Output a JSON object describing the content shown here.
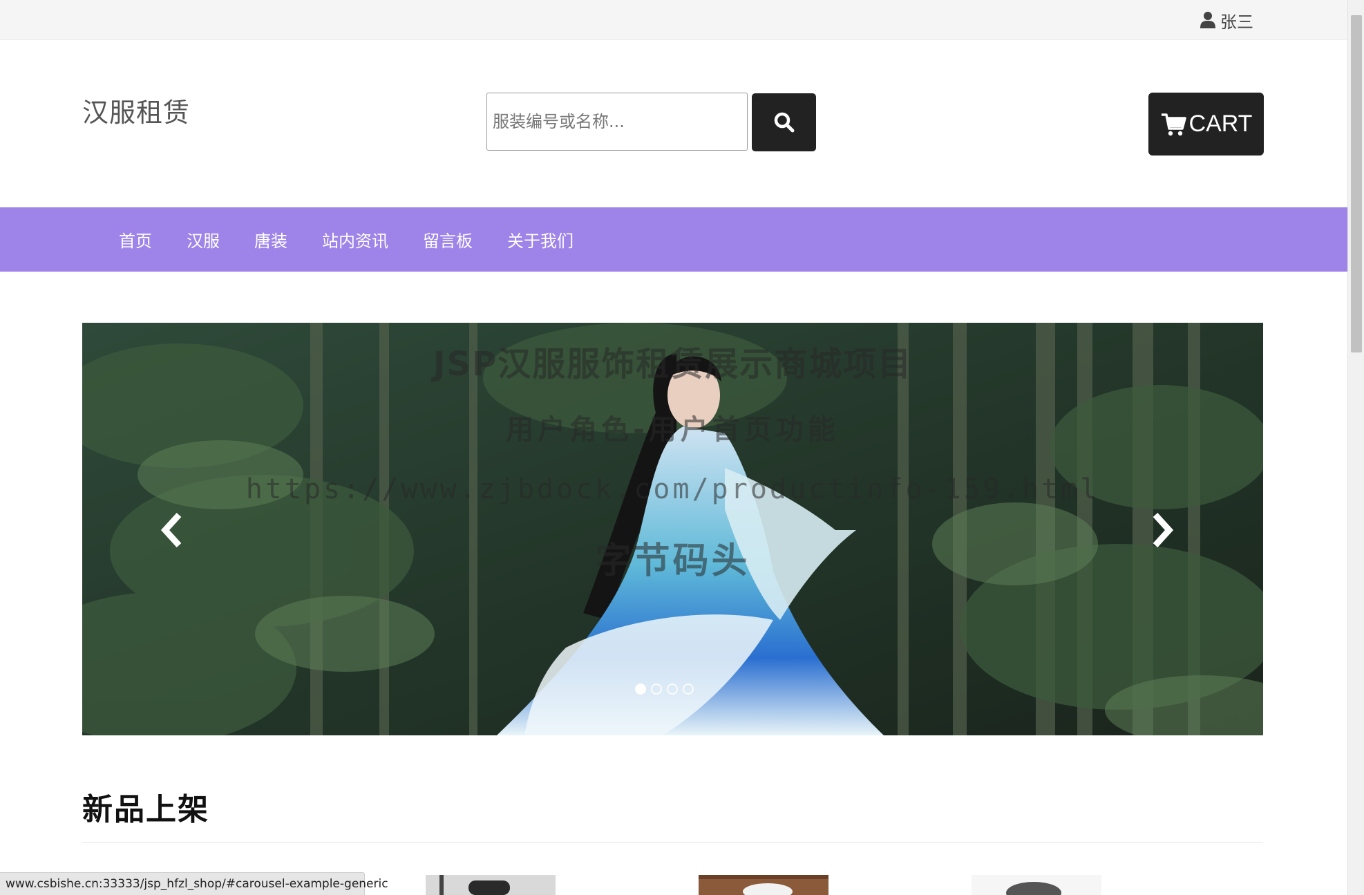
{
  "topbar": {
    "user_name": "张三",
    "user_icon": "user-icon"
  },
  "header": {
    "logo": "汉服租赁",
    "search_placeholder": "服装编号或名称...",
    "search_icon": "search-icon",
    "cart_label": "CART",
    "cart_icon": "cart-icon"
  },
  "nav": {
    "items": [
      {
        "label": "首页"
      },
      {
        "label": "汉服"
      },
      {
        "label": "唐装"
      },
      {
        "label": "站内资讯"
      },
      {
        "label": "留言板"
      },
      {
        "label": "关于我们"
      }
    ]
  },
  "carousel": {
    "caption_line1": "JSP汉服服饰租赁展示商城项目",
    "caption_line2": "用户角色-用户首页功能",
    "caption_line3": "https://www.zjbdock.com/productinfo-159.html",
    "caption_line4": "字节码头",
    "prev_icon": "chevron-left-icon",
    "next_icon": "chevron-right-icon",
    "indicator_count": 4,
    "active_indicator": 0
  },
  "section": {
    "title": "新品上架"
  },
  "statusbar": {
    "url": "www.csbishe.cn:33333/jsp_hfzl_shop/#carousel-example-generic"
  },
  "colors": {
    "nav_bg": "#9e83e8",
    "button_dark": "#222222",
    "topbar_bg": "#f5f5f5"
  }
}
